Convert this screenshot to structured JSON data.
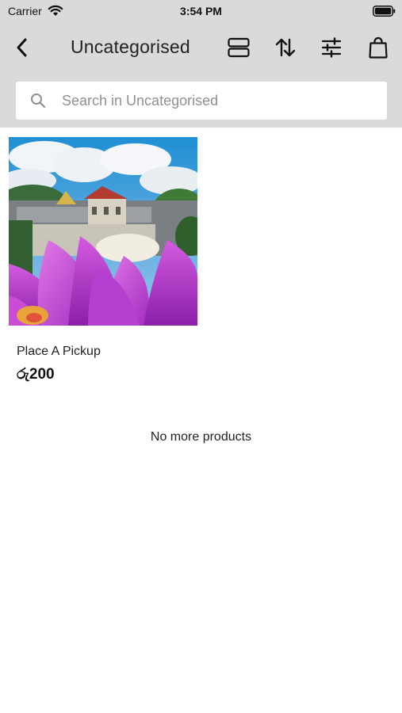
{
  "status_bar": {
    "carrier": "Carrier",
    "time": "3:54 PM",
    "wifi_icon": "wifi-icon",
    "battery_icon": "battery-icon"
  },
  "nav": {
    "title": "Uncategorised",
    "icons": {
      "back": "chevron-left-icon",
      "layout": "layout-list-icon",
      "sort": "sort-arrows-icon",
      "filter": "filter-sliders-icon",
      "cart": "shopping-bag-icon"
    }
  },
  "search": {
    "placeholder": "Search in Uncategorised",
    "value": ""
  },
  "products": [
    {
      "name": "Place A Pickup",
      "price": "රු200"
    }
  ],
  "footer_message": "No more products",
  "colors": {
    "header_background": "#d9dadb",
    "page_background": "#ffffff",
    "placeholder": "#8e9194",
    "text": "#222222"
  }
}
